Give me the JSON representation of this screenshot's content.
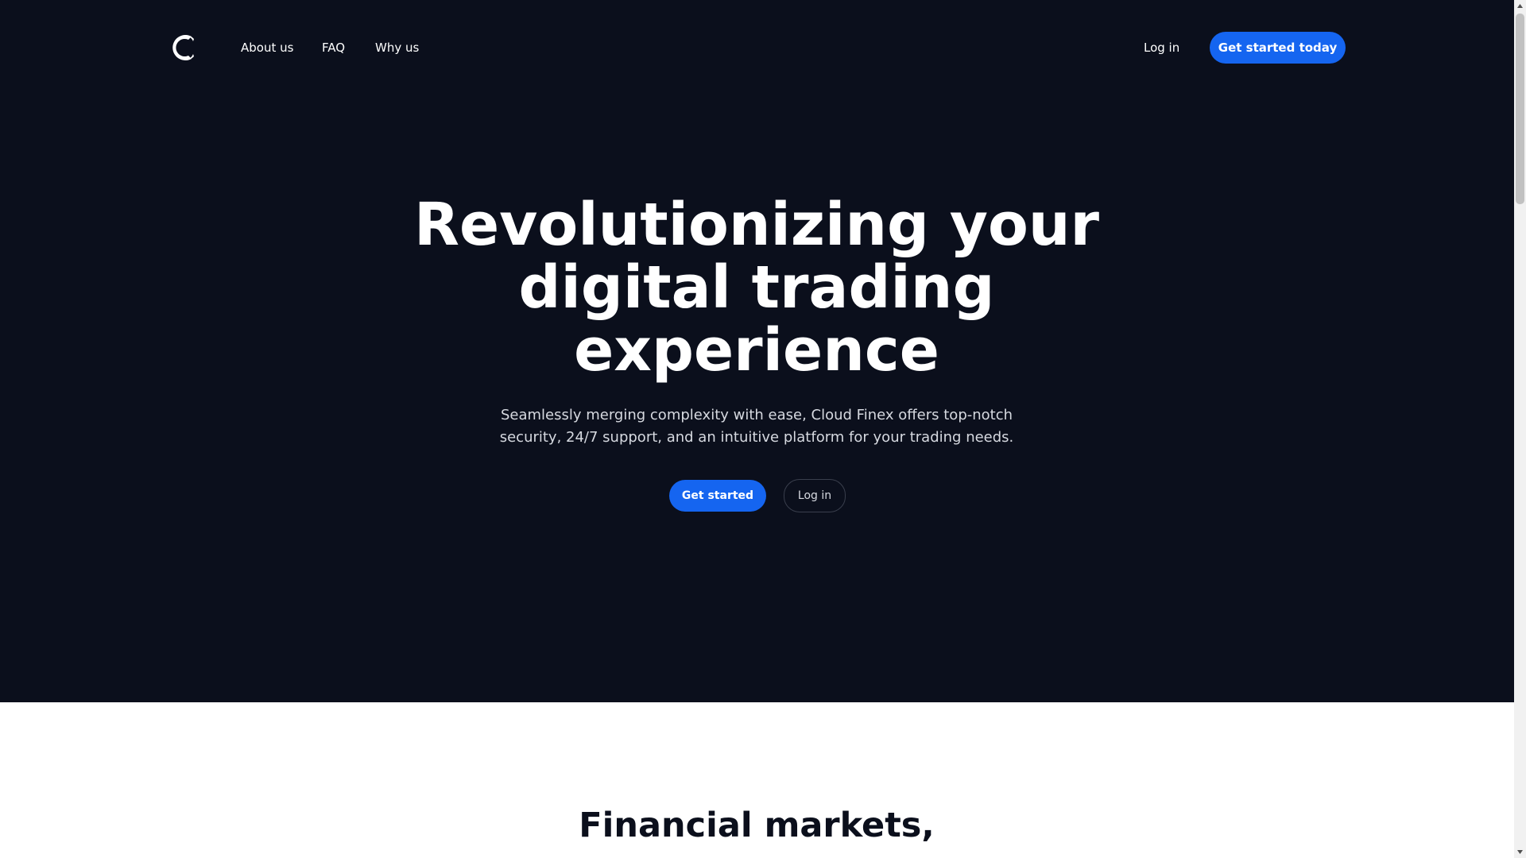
{
  "nav": {
    "logo_icon": "crescent-c-logo",
    "links": [
      {
        "label": "About us"
      },
      {
        "label": "FAQ"
      },
      {
        "label": "Why us"
      }
    ],
    "login_label": "Log in",
    "cta_label": "Get started today"
  },
  "hero": {
    "title_lines": [
      "Revolutionizing your",
      "digital trading",
      "experience"
    ],
    "subtitle": "Seamlessly merging complexity with ease, Cloud Finex offers top-notch security, 24/7 support, and an intuitive platform for your trading needs.",
    "primary_button": "Get started",
    "secondary_button": "Log in"
  },
  "section": {
    "title_line_1": "Financial markets,"
  },
  "colors": {
    "hero_background": "#0b0f1c",
    "accent": "#1565f0",
    "text_light": "#ffffff",
    "text_dark": "#0b0f1c"
  },
  "scrollbar": {
    "up_icon": "triangle-up-icon",
    "down_icon": "triangle-down-icon"
  }
}
